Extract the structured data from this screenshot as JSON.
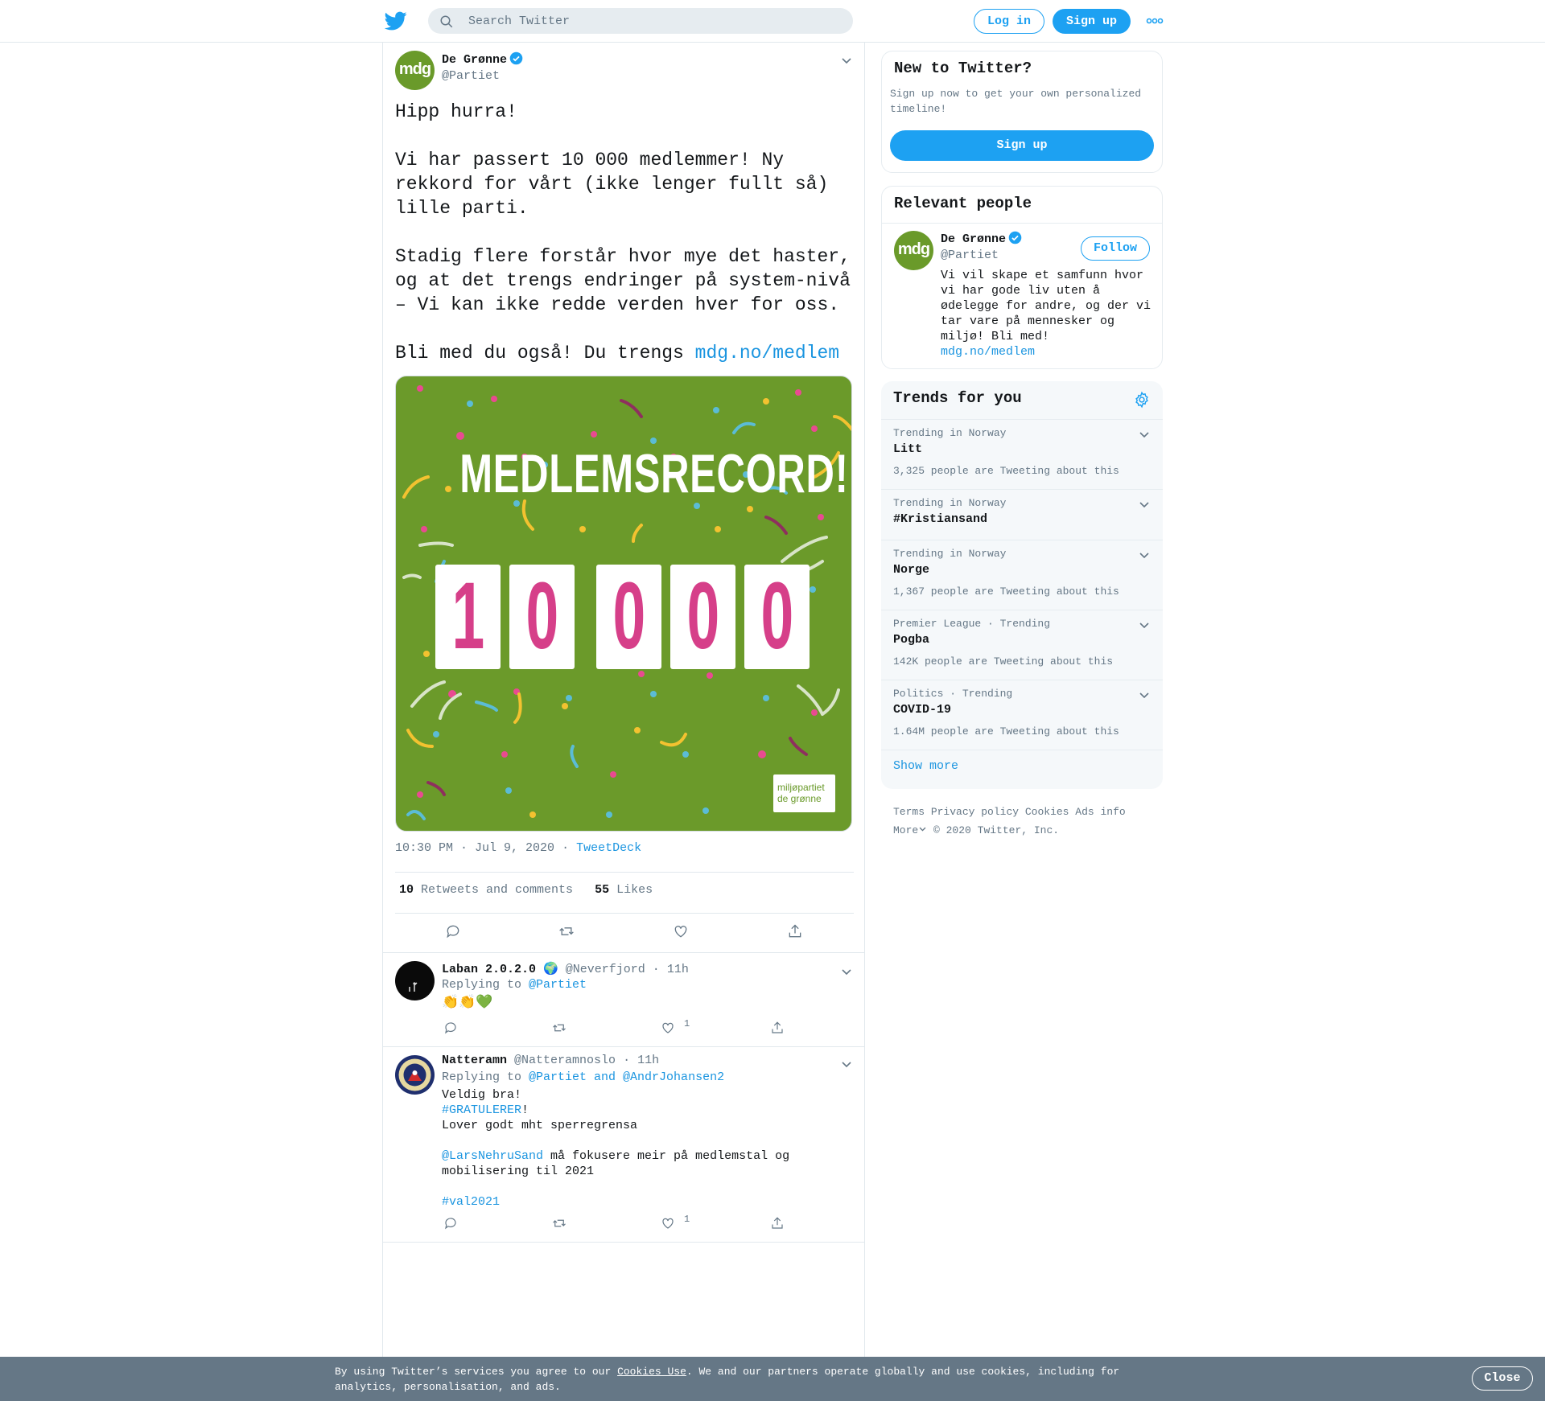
{
  "header": {
    "search_placeholder": "Search Twitter",
    "login_label": "Log in",
    "signup_label": "Sign up"
  },
  "tweet": {
    "author_name": "De Grønne",
    "author_handle": "@Partiet",
    "avatar_text": "mdg",
    "text_main": "Hipp hurra!\n\nVi har passert 10 000 medlemmer! Ny rekkord for vårt (ikke lenger fullt så) lille parti.\n\nStadig flere forstår hvor mye det haster, og at det trengs endringer på system-nivå – Vi kan ikke redde verden hver for oss.\n\nBli med du også! Du trengs ",
    "text_link": "mdg.no/medlem",
    "image": {
      "headline": "MEDLEMSRECORD!",
      "digits": [
        "1",
        "0",
        "0",
        "0",
        "0"
      ],
      "brand_line1": "miljøpartiet",
      "brand_line2": "de grønne"
    },
    "timestamp": "10:30 PM · Jul 9, 2020",
    "separator": "·",
    "source": "TweetDeck",
    "retweets_count": "10",
    "retweets_label": "Retweets and comments",
    "likes_count": "55",
    "likes_label": "Likes"
  },
  "replies": [
    {
      "name": "Laban 2.0.2.0",
      "emoji": "🌍",
      "handle": "@Neverfjord",
      "dot": "·",
      "time": "11h",
      "replying_prefix": "Replying to ",
      "replying_to": "@Partiet",
      "body": "👏👏💚",
      "like_count": "1"
    },
    {
      "name": "Natteramn",
      "handle": "@Natteramnoslo",
      "dot": "·",
      "time": "11h",
      "replying_prefix": "Replying to ",
      "replying_to": "@Partiet and @AndrJohansen2",
      "body_line1": "Veldig bra!",
      "body_hashtag1": "#GRATULERER",
      "body_excl": "!",
      "body_line3": "Lover godt mht sperregrensa",
      "body_mention": "@LarsNehruSand",
      "body_line5": " må fokusere meir på medlemstal og mobilisering til 2021",
      "body_hashtag2": "#val2021",
      "like_count": "1"
    }
  ],
  "sidebar": {
    "new_title": "New to Twitter?",
    "new_text": "Sign up now to get your own personalized timeline!",
    "new_signup": "Sign up",
    "relevant_title": "Relevant people",
    "person_name": "De Grønne",
    "person_handle": "@Partiet",
    "person_avatar": "mdg",
    "follow_label": "Follow",
    "person_bio": "Vi vil skape et samfunn hvor vi har gode liv uten å ødelegge for andre, og der vi tar vare på mennesker og miljø! Bli med!",
    "person_link": "mdg.no/medlem",
    "trends_title": "Trends for you",
    "trends": [
      {
        "category": "Trending in Norway",
        "name": "Litt",
        "count": "3,325 people are Tweeting about this"
      },
      {
        "category": "Trending in Norway",
        "name": "#Kristiansand",
        "count": ""
      },
      {
        "category": "Trending in Norway",
        "name": "Norge",
        "count": "1,367 people are Tweeting about this"
      },
      {
        "category": "Premier League · Trending",
        "name": "Pogba",
        "count": "142K people are Tweeting about this"
      },
      {
        "category": "Politics · Trending",
        "name": "COVID-19",
        "count": "1.64M people are Tweeting about this"
      }
    ],
    "show_more": "Show more",
    "footer": {
      "terms": "Terms",
      "privacy": "Privacy policy",
      "cookies": "Cookies",
      "ads": "Ads info",
      "more": "More",
      "copyright": "© 2020 Twitter, Inc."
    }
  },
  "cookie_bar": {
    "text_before": "By using Twitter’s services you agree to our ",
    "link": "Cookies Use",
    "text_after": ". We and our partners operate globally and use cookies, including for analytics, personalisation, and ads.",
    "close_label": "Close"
  },
  "colors": {
    "brand_blue": "#1da1f2",
    "mdg_green": "#6a9a2a",
    "digit_pink": "#d63f89"
  }
}
